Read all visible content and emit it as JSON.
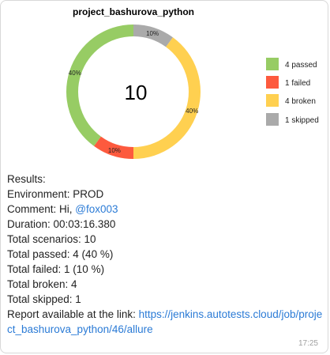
{
  "chart_data": {
    "type": "pie",
    "title": "project_bashurova_python",
    "total": "10",
    "slices": [
      {
        "name": "passed",
        "value": 4,
        "percent_label": "40%",
        "color": "#97cc64",
        "legend": "4 passed"
      },
      {
        "name": "failed",
        "value": 1,
        "percent_label": "10%",
        "color": "#fd5a3e",
        "legend": "1 failed"
      },
      {
        "name": "broken",
        "value": 4,
        "percent_label": "40%",
        "color": "#ffd050",
        "legend": "4 broken"
      },
      {
        "name": "skipped",
        "value": 1,
        "percent_label": "10%",
        "color": "#aaaaaa",
        "legend": "1 skipped"
      }
    ]
  },
  "message": {
    "results": "Results:",
    "environment_label": "Environment: ",
    "environment_value": "PROD",
    "comment_label": "Comment: Hi, ",
    "comment_mention": "@fox003",
    "duration": "Duration: 00:03:16.380",
    "total_scenarios": "Total scenarios: 10",
    "total_passed": "Total passed: 4 (40 %)",
    "total_failed": "Total failed: 1 (10 %)",
    "total_broken": "Total broken: 4",
    "total_skipped": "Total skipped: 1",
    "report_text": "Report available at the link: ",
    "report_link": "https://jenkins.autotests.cloud/job/project_bashurova_python/46/allure",
    "time": "17:25"
  }
}
